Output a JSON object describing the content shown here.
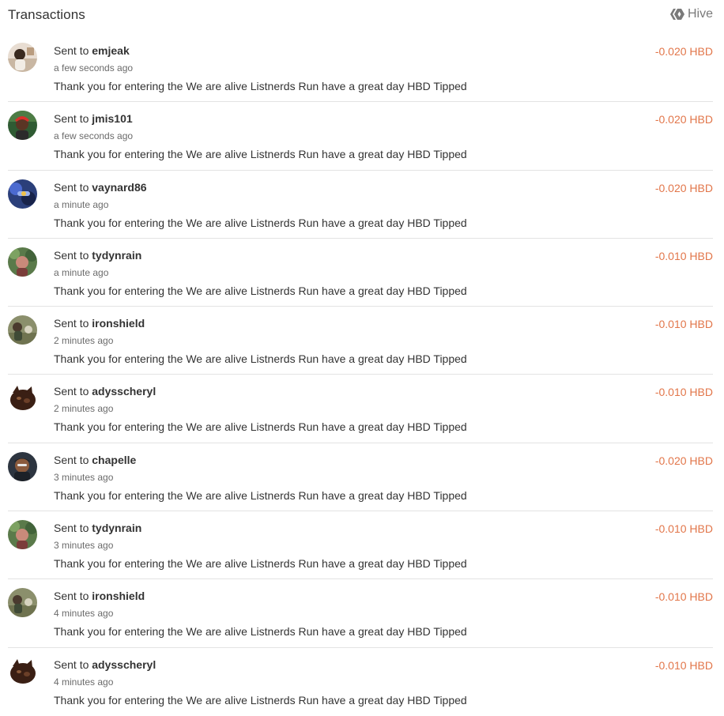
{
  "header": {
    "title": "Transactions",
    "brand_label": "Hive",
    "brand_icon": "hive-logo-icon"
  },
  "colors": {
    "amount": "#e2764a",
    "muted": "#6b6b6b",
    "text": "#333333",
    "divider": "#e3e3e3"
  },
  "transactions": [
    {
      "prefix": "Sent to",
      "user": "emjeak",
      "time": "a few seconds ago",
      "memo": "Thank you for entering the We are alive Listnerds Run have a great day HBD Tipped",
      "amount": "-0.020 HBD",
      "avatar": "avatar-emjeak"
    },
    {
      "prefix": "Sent to",
      "user": "jmis101",
      "time": "a few seconds ago",
      "memo": "Thank you for entering the We are alive Listnerds Run have a great day HBD Tipped",
      "amount": "-0.020 HBD",
      "avatar": "avatar-jmis101"
    },
    {
      "prefix": "Sent to",
      "user": "vaynard86",
      "time": "a minute ago",
      "memo": "Thank you for entering the We are alive Listnerds Run have a great day HBD Tipped",
      "amount": "-0.020 HBD",
      "avatar": "avatar-vaynard86"
    },
    {
      "prefix": "Sent to",
      "user": "tydynrain",
      "time": "a minute ago",
      "memo": "Thank you for entering the We are alive Listnerds Run have a great day HBD Tipped",
      "amount": "-0.010 HBD",
      "avatar": "avatar-tydynrain"
    },
    {
      "prefix": "Sent to",
      "user": "ironshield",
      "time": "2 minutes ago",
      "memo": "Thank you for entering the We are alive Listnerds Run have a great day HBD Tipped",
      "amount": "-0.010 HBD",
      "avatar": "avatar-ironshield"
    },
    {
      "prefix": "Sent to",
      "user": "adysscheryl",
      "time": "2 minutes ago",
      "memo": "Thank you for entering the We are alive Listnerds Run have a great day HBD Tipped",
      "amount": "-0.010 HBD",
      "avatar": "avatar-adysscheryl"
    },
    {
      "prefix": "Sent to",
      "user": "chapelle",
      "time": "3 minutes ago",
      "memo": "Thank you for entering the We are alive Listnerds Run have a great day HBD Tipped",
      "amount": "-0.020 HBD",
      "avatar": "avatar-chapelle"
    },
    {
      "prefix": "Sent to",
      "user": "tydynrain",
      "time": "3 minutes ago",
      "memo": "Thank you for entering the We are alive Listnerds Run have a great day HBD Tipped",
      "amount": "-0.010 HBD",
      "avatar": "avatar-tydynrain"
    },
    {
      "prefix": "Sent to",
      "user": "ironshield",
      "time": "4 minutes ago",
      "memo": "Thank you for entering the We are alive Listnerds Run have a great day HBD Tipped",
      "amount": "-0.010 HBD",
      "avatar": "avatar-ironshield"
    },
    {
      "prefix": "Sent to",
      "user": "adysscheryl",
      "time": "4 minutes ago",
      "memo": "Thank you for entering the We are alive Listnerds Run have a great day HBD Tipped",
      "amount": "-0.010 HBD",
      "avatar": "avatar-adysscheryl"
    }
  ]
}
